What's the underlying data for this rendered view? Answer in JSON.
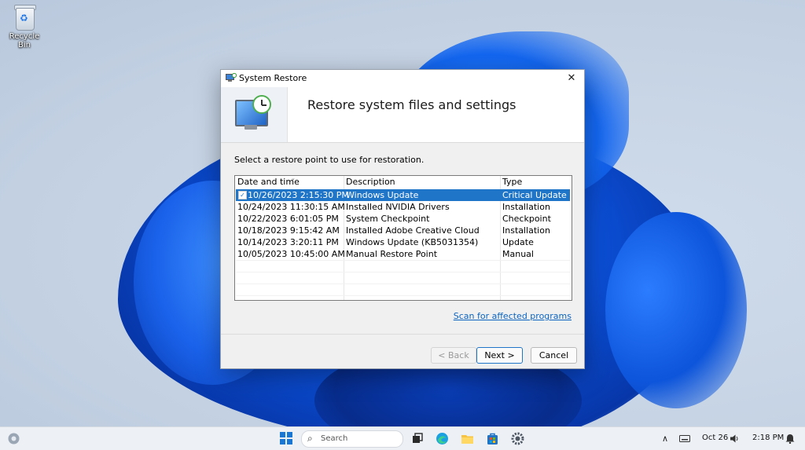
{
  "desktop": {
    "recycle_bin_label": "Recycle Bin"
  },
  "dialog": {
    "title": "System Restore",
    "header_title": "Restore system files and settings",
    "instruction": "Select a restore point to use for restoration.",
    "columns": {
      "date": "Date and time",
      "description": "Description",
      "type": "Type"
    },
    "rows": [
      {
        "date": "10/26/2023 2:15:30 PM",
        "description": "Windows Update",
        "type": "Critical Update",
        "selected": true
      },
      {
        "date": "10/24/2023 11:30:15 AM",
        "description": "Installed NVIDIA Drivers",
        "type": "Installation",
        "selected": false
      },
      {
        "date": "10/22/2023 6:01:05 PM",
        "description": "System Checkpoint",
        "type": "Checkpoint",
        "selected": false
      },
      {
        "date": "10/18/2023 9:15:42 AM",
        "description": "Installed Adobe Creative Cloud",
        "type": "Installation",
        "selected": false
      },
      {
        "date": "10/14/2023 3:20:11 PM",
        "description": "Windows Update (KB5031354)",
        "type": "Update",
        "selected": false
      },
      {
        "date": "10/05/2023 10:45:00 AM",
        "description": "Manual Restore Point",
        "type": "Manual",
        "selected": false
      }
    ],
    "scan_link": "Scan for affected programs",
    "back_label": "< Back",
    "next_label": "Next >",
    "cancel_label": "Cancel",
    "close_glyph": "✕"
  },
  "taskbar": {
    "search_placeholder": "Search",
    "date": "Oct 26",
    "time": "2:18 PM"
  },
  "colors": {
    "selection": "#1f75c8",
    "link": "#0c64c0",
    "accent": "#1976d2"
  }
}
